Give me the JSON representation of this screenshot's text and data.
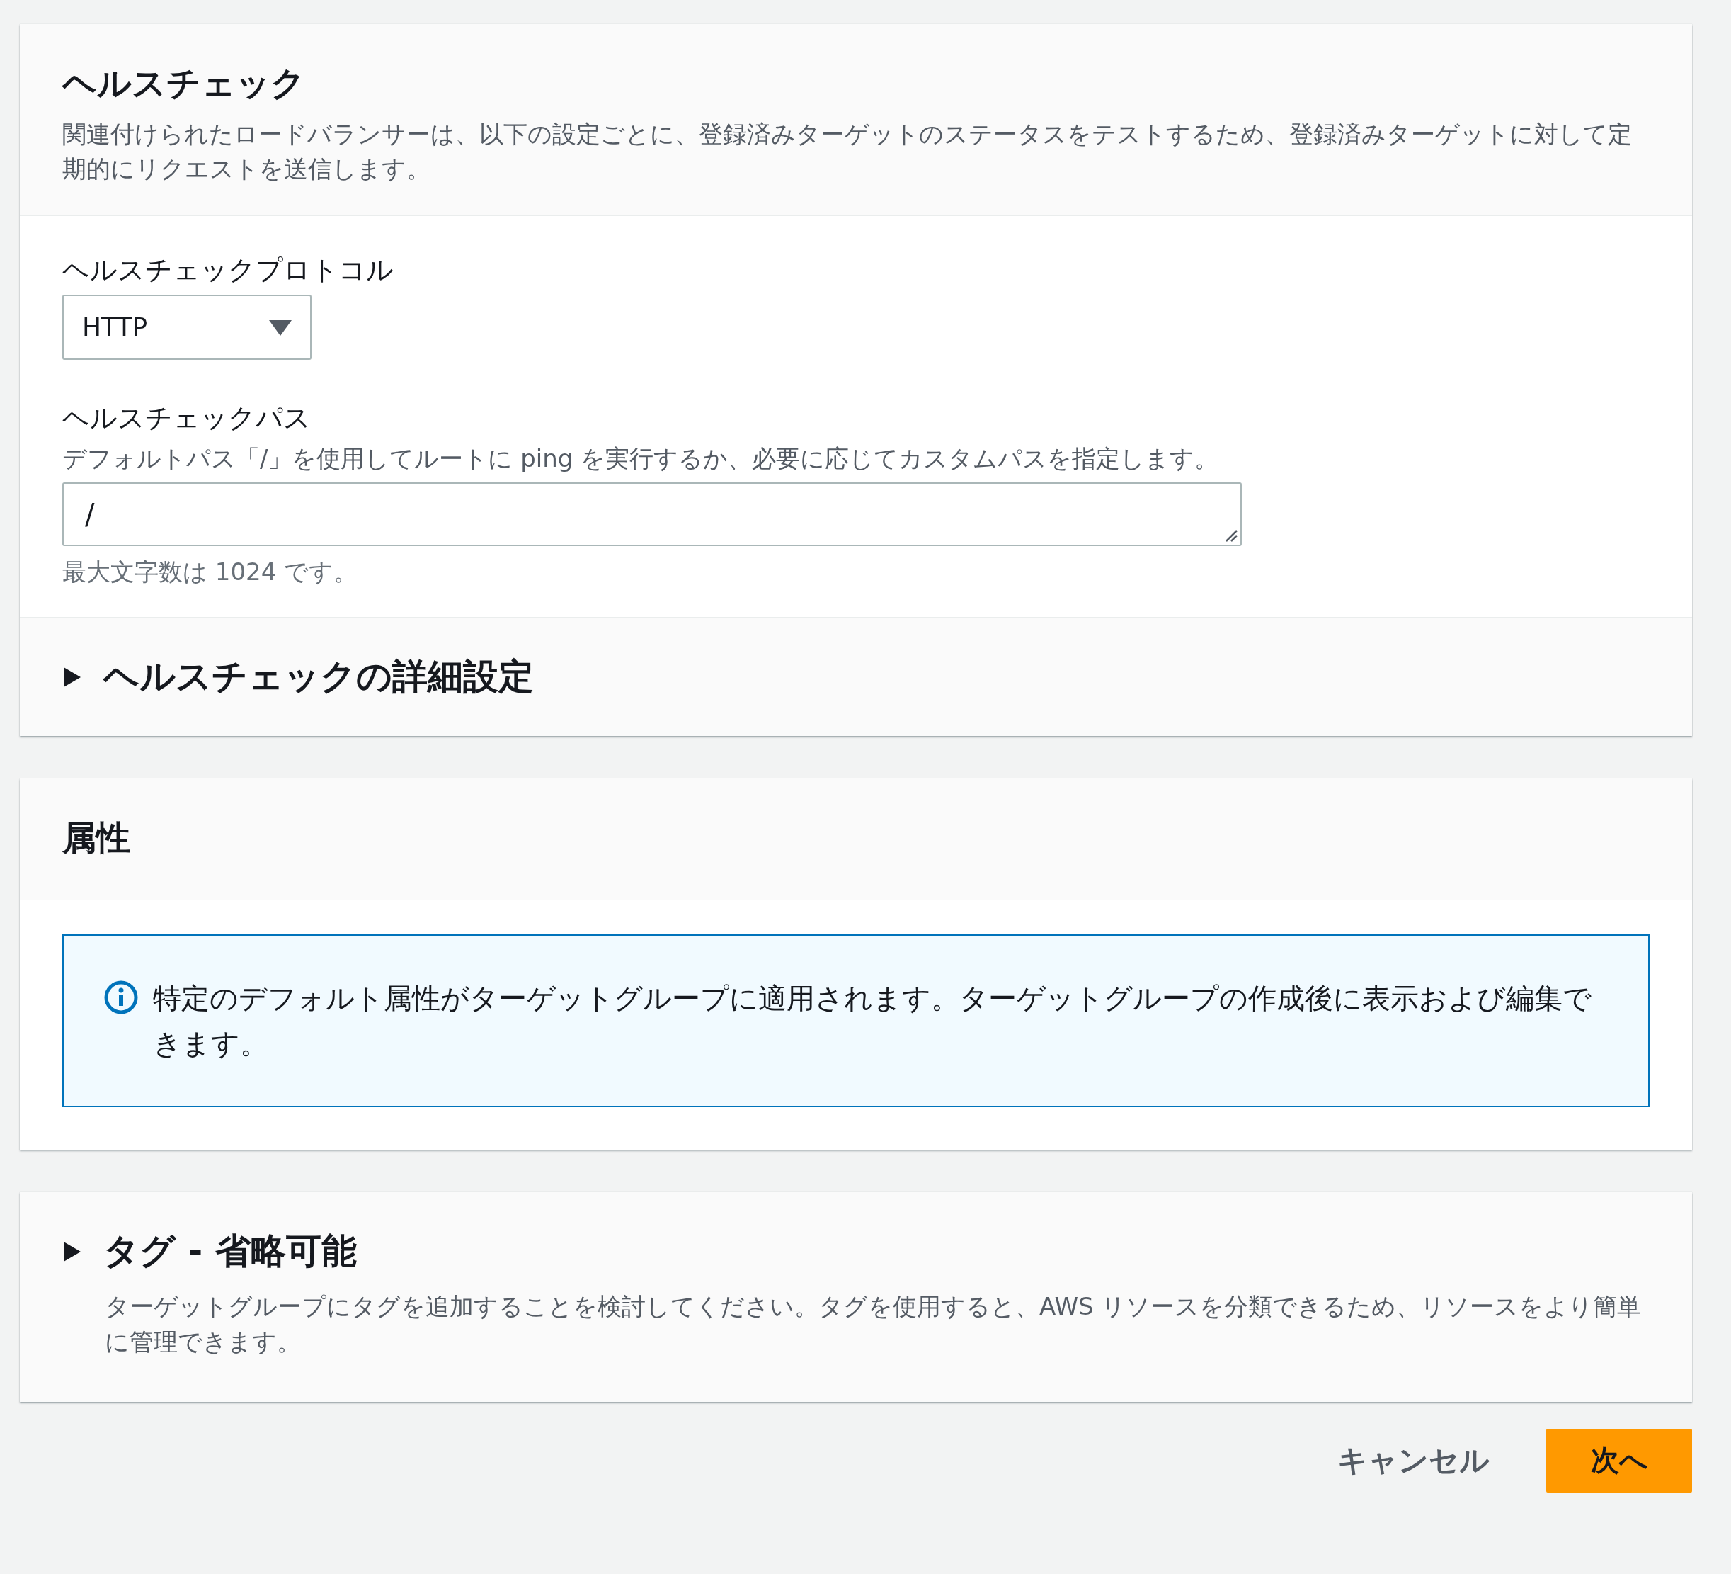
{
  "health_check": {
    "title": "ヘルスチェック",
    "description": "関連付けられたロードバランサーは、以下の設定ごとに、登録済みターゲットのステータスをテストするため、登録済みターゲットに対して定期的にリクエストを送信します。",
    "protocol": {
      "label": "ヘルスチェックプロトコル",
      "value": "HTTP"
    },
    "path": {
      "label": "ヘルスチェックパス",
      "hint": "デフォルトパス「/」を使用してルートに ping を実行するか、必要に応じてカスタムパスを指定します。",
      "value": "/",
      "constraint": "最大文字数は 1024 です。"
    },
    "advanced": {
      "title": "ヘルスチェックの詳細設定",
      "expanded": false
    }
  },
  "attributes": {
    "title": "属性",
    "info": "特定のデフォルト属性がターゲットグループに適用されます。ターゲットグループの作成後に表示および編集できます。"
  },
  "tags": {
    "title": "タグ - 省略可能",
    "description": "ターゲットグループにタグを追加することを検討してください。タグを使用すると、AWS リソースを分類できるため、リソースをより簡単に管理できます。",
    "expanded": false
  },
  "buttons": [
    {
      "label": "キャンセル",
      "kind": "link"
    },
    {
      "label": "次へ",
      "kind": "primary"
    }
  ]
}
